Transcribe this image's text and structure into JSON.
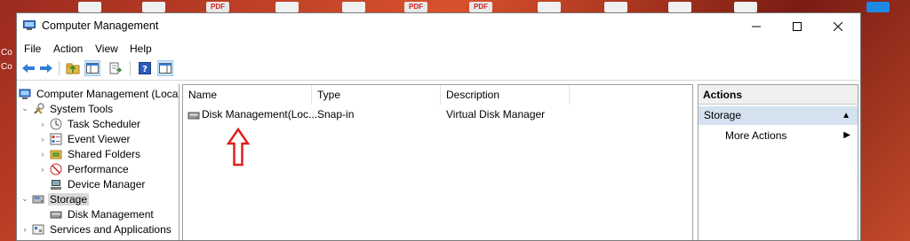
{
  "window": {
    "title": "Computer Management"
  },
  "desktop": {
    "pdf_label": "PDF",
    "left_labels": [
      "Co",
      "Co"
    ]
  },
  "menu": [
    "File",
    "Action",
    "View",
    "Help"
  ],
  "tree": [
    {
      "label": "Computer Management (Local)"
    },
    {
      "label": "System Tools"
    },
    {
      "label": "Task Scheduler"
    },
    {
      "label": "Event Viewer"
    },
    {
      "label": "Shared Folders"
    },
    {
      "label": "Performance"
    },
    {
      "label": "Device Manager"
    },
    {
      "label": "Storage"
    },
    {
      "label": "Disk Management"
    },
    {
      "label": "Services and Applications"
    }
  ],
  "list": {
    "columns": [
      "Name",
      "Type",
      "Description"
    ],
    "rows": [
      {
        "name": "Disk Management(Loc...",
        "type": "Snap-in",
        "description": "Virtual Disk Manager"
      }
    ]
  },
  "actions": {
    "title": "Actions",
    "section": "Storage",
    "items": [
      "More Actions"
    ]
  },
  "colors": {
    "annotation_arrow": "#e0201c",
    "selection": "#d9d9d9",
    "actions_section": "#d4e2f0"
  }
}
